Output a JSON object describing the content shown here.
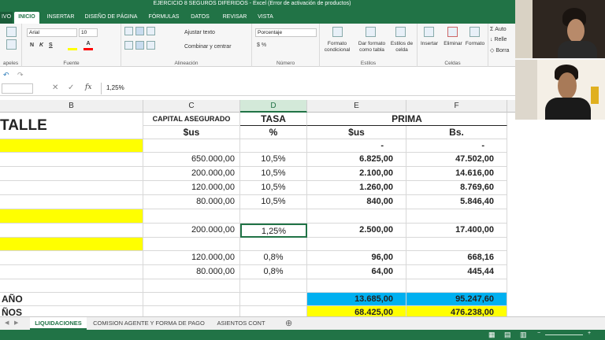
{
  "window": {
    "title": "EJERCICIO 8 SEGUROS DIFERIDOS -  Excel (Error de activación de productos)",
    "file_tab": "IVO"
  },
  "ribbon_tabs": [
    "INICIO",
    "INSERTAR",
    "DISEÑO DE PÁGINA",
    "FÓRMULAS",
    "DATOS",
    "REVISAR",
    "VISTA"
  ],
  "ribbon": {
    "font_name": "Arial",
    "font_size": "10",
    "number_format": "Porcentaje",
    "bold": "N",
    "italic": "K",
    "underline": "S",
    "wrap_text": "Ajustar texto",
    "merge_center": "Combinar y centrar",
    "conditional_format": "Formato condicional",
    "format_table": "Dar formato como tabla",
    "cell_styles": "Estilos de celda",
    "insert": "Insertar",
    "delete": "Eliminar",
    "format": "Formato",
    "autosum": "Auto",
    "fill": "Relle",
    "clear": "Borra",
    "group_clipboard": "apeles",
    "group_font": "Fuente",
    "group_alignment": "Alineación",
    "group_number": "Número",
    "group_styles": "Estilos",
    "group_cells": "Celdas"
  },
  "formula_bar": {
    "fx": "fx",
    "content": "1,25%"
  },
  "columns": [
    "B",
    "C",
    "D",
    "E",
    "F"
  ],
  "sheet": {
    "header1": {
      "b": "TALLE",
      "c": "CAPITAL ASEGURADO",
      "d": "TASA",
      "ef": "PRIMA"
    },
    "header2": {
      "c": "$us",
      "d": "%",
      "e": "$us",
      "f": "Bs."
    },
    "dash_row": {
      "e": "-",
      "f": "-"
    },
    "group1": [
      {
        "c": "650.000,00",
        "d": "10,5%",
        "e": "6.825,00",
        "f": "47.502,00"
      },
      {
        "c": "200.000,00",
        "d": "10,5%",
        "e": "2.100,00",
        "f": "14.616,00"
      },
      {
        "c": "120.000,00",
        "d": "10,5%",
        "e": "1.260,00",
        "f": "8.769,60"
      },
      {
        "c": "80.000,00",
        "d": "10,5%",
        "e": "840,00",
        "f": "5.846,40"
      }
    ],
    "group2": [
      {
        "c": "200.000,00",
        "d": "1,25%",
        "e": "2.500,00",
        "f": "17.400,00"
      }
    ],
    "group3": [
      {
        "c": "120.000,00",
        "d": "0,8%",
        "e": "96,00",
        "f": "668,16"
      },
      {
        "c": "80.000,00",
        "d": "0,8%",
        "e": "64,00",
        "f": "445,44"
      }
    ],
    "total_year": {
      "b": "AÑO",
      "e": "13.685,00",
      "f": "95.247,60"
    },
    "total_all": {
      "b": "ÑOS",
      "e": "68.425,00",
      "f": "476.238,00"
    }
  },
  "sheet_tabs": [
    "LIQUIDACIONES",
    "COMISION AGENTE Y FORMA DE PAGO",
    "ASIENTOS CONT"
  ],
  "colors": {
    "excel_green": "#217346",
    "highlight_yellow": "#ffff00",
    "highlight_blue": "#00b0f0"
  }
}
